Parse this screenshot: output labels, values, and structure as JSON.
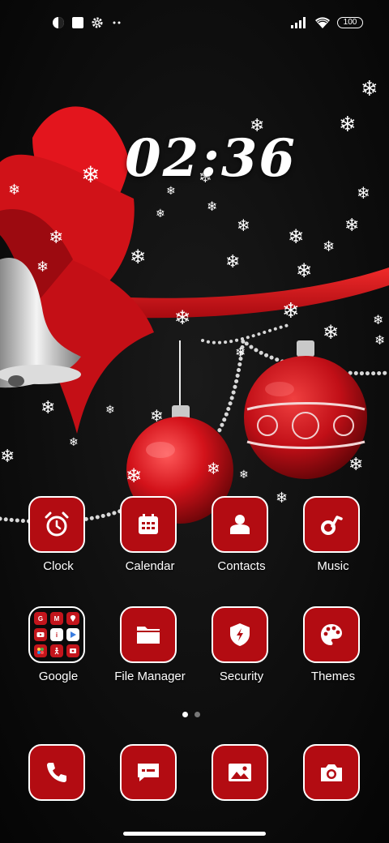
{
  "status_bar": {
    "left_icons": [
      "app-notification-icon",
      "square-notification-icon",
      "gear-icon",
      "more-dots-icon"
    ],
    "right_icons": [
      "signal-icon",
      "wifi-icon"
    ],
    "battery": "100"
  },
  "clock": {
    "time": "02:36"
  },
  "apps": {
    "clock": "Clock",
    "calendar": "Calendar",
    "contacts": "Contacts",
    "music": "Music",
    "google": "Google",
    "file_manager": "File Manager",
    "security": "Security",
    "themes": "Themes"
  },
  "google_folder_icons": [
    "G",
    "M",
    "maps",
    "YT",
    "i",
    "Play",
    "photos",
    "x",
    "tv"
  ],
  "dock": [
    "phone-icon",
    "messages-icon",
    "gallery-icon",
    "camera-icon"
  ],
  "pages": {
    "count": 2,
    "current": 1
  },
  "colors": {
    "tile": "#b30c12",
    "tile_border": "#ffffff",
    "accent_red": "#d9141c"
  }
}
